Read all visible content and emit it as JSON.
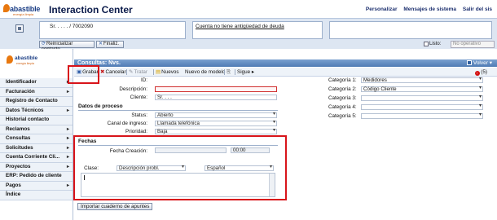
{
  "header": {
    "logo_text": "abastible",
    "logo_slogan": "energía limpia",
    "title": "Interaction Center",
    "links": [
      "Personalizar",
      "Mensajes de sistema",
      "Salir del sis"
    ]
  },
  "context": {
    "account_text": "Sr. . . . . / 7002090",
    "notice_text": "Cuenta no tiene antigüedad de deuda",
    "buttons": {
      "reset": "Reinicializar contacto",
      "finalize": "Finaliz."
    },
    "ready_label": "Listo",
    "status_value": "No operativo"
  },
  "sidebar": {
    "logo_text": "abastible",
    "logo_slogan": "energía limpia",
    "items": [
      {
        "label": "Identificador",
        "arrow": "▸"
      },
      {
        "label": "Facturación",
        "arrow": "▸"
      },
      {
        "label": "Registro de Contacto",
        "arrow": ""
      },
      {
        "label": "Datos Técnicos",
        "arrow": "▸"
      },
      {
        "label": "Historial contacto",
        "arrow": ""
      },
      {
        "label": "Reclamos",
        "arrow": "▸"
      },
      {
        "label": "Consultas",
        "arrow": "▸"
      },
      {
        "label": "Solicitudes",
        "arrow": "▸"
      },
      {
        "label": "Cuenta Corriente Cli...",
        "arrow": "▸"
      },
      {
        "label": "Proyectos",
        "arrow": "▸"
      },
      {
        "label": "ERP: Pedido de cliente",
        "arrow": ""
      },
      {
        "label": "Pagos",
        "arrow": "▸"
      },
      {
        "label": "Índice",
        "arrow": ""
      }
    ]
  },
  "main": {
    "title": "Consultas: Nvs.",
    "back_label": "Volver",
    "back_arrow": "▾",
    "toolbar": {
      "save": "Grabar",
      "cancel": "Cancelar",
      "process": "Tratar",
      "new": "Nuevos",
      "new_model": "Nuevo de modelo",
      "next": "Sigue",
      "alert_count": "(5)"
    },
    "form": {
      "id_label": "ID:",
      "description_label": "Descripción:",
      "client_label": "Cliente:",
      "client_value": "Sr. . . .",
      "process_section": "Datos de proceso",
      "status_label": "Status:",
      "status_value": "Abierto",
      "channel_label": "Canal de ingreso:",
      "channel_value": "Llamada telefónica",
      "priority_label": "Prioridad:",
      "priority_value": "Baja",
      "dates_section": "Fechas",
      "created_label": "Fecha Creación:",
      "created_time": "00:00",
      "class_label": "Clase:",
      "class_value": "Descripción probl.",
      "language_value": "Español",
      "import_button": "Importar cuaderno de apuntes"
    },
    "categories": [
      {
        "label": "Categoría 1:",
        "value": "Medidores"
      },
      {
        "label": "Categoría 2:",
        "value": "Código Cliente"
      },
      {
        "label": "Categoría 3:",
        "value": ""
      },
      {
        "label": "Categoría 4:",
        "value": ""
      },
      {
        "label": "Categoría 5:",
        "value": ""
      }
    ]
  },
  "colors": {
    "highlight": "#d8141a",
    "title_bar": "#4f7bb4",
    "nav_background": "#edf2f8"
  }
}
